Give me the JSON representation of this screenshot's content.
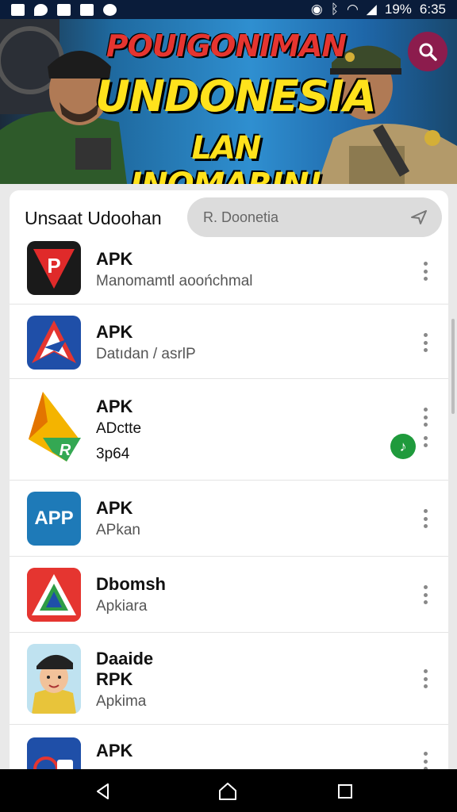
{
  "status_bar": {
    "battery": "19%",
    "time": "6:35"
  },
  "banner": {
    "line1": "POUIGONIMAN",
    "line2": "UNDONESIA",
    "line3": "LAN INOMARIN!"
  },
  "header": {
    "title": "Unsaat Udoohan",
    "search_value": "R. Doonetia"
  },
  "apps": [
    {
      "title": "APK",
      "subtitle": "Manomamtl aoońchmal",
      "icon": "red-p-icon"
    },
    {
      "title": "APK",
      "subtitle": "Datıdan / asrlP",
      "icon": "blue-arrow-icon"
    },
    {
      "title": "APK",
      "subtitle": "ADctte",
      "subtitle2": "3p64",
      "icon": "yellow-green-a-icon",
      "badge": "♪"
    },
    {
      "title": "APK",
      "subtitle": "APkan",
      "icon": "app-text-icon",
      "icon_text": "APP"
    },
    {
      "title": "Dbomsh",
      "subtitle": "Apkiara",
      "icon": "triangle-logo-icon"
    },
    {
      "title": "Daaide",
      "title2": "RPK",
      "subtitle": "Apkima",
      "icon": "cartoon-man-icon"
    },
    {
      "title": "APK",
      "subtitle": "",
      "icon": "blue-partial-icon"
    }
  ],
  "colors": {
    "status_bar": "#0a1c3a",
    "accent_red": "#e53530",
    "banner_yellow": "#ffe21c",
    "badge_green": "#1f9a3c",
    "search_fab": "#8c1c4d"
  }
}
